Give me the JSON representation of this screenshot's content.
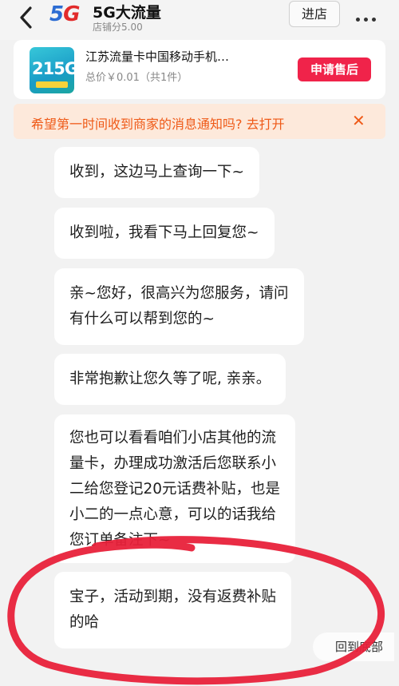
{
  "header": {
    "logo_5": "5",
    "logo_g": "G",
    "shop_name": "5G大流量",
    "shop_score": "店铺分5.00",
    "enter_store": "进店"
  },
  "product": {
    "thumb_text": "215G",
    "title": "江苏流量卡中国移动手机…",
    "price": "总价￥0.01（共1件）",
    "aftersale": "申请售后"
  },
  "notify": {
    "text": "希望第一时间收到商家的消息通知吗? 去打开",
    "close": "✕"
  },
  "messages": [
    {
      "lines": [
        "收到，这边马上查询一下~"
      ]
    },
    {
      "lines": [
        "收到啦，我看下马上回复您~"
      ]
    },
    {
      "lines": [
        "亲~您好，很高兴为您服务，请问",
        "有什么可以帮到您的~"
      ]
    },
    {
      "lines": [
        "非常抱歉让您久等了呢, 亲亲。"
      ]
    },
    {
      "lines": [
        "您也可以看看咱们小店其他的流",
        "量卡，办理成功激活后您联系小",
        "二给您登记20元话费补贴，也是",
        "小二的一点心意，可以的话我给",
        "您订单备注下~"
      ]
    },
    {
      "lines": [
        "宝子，活动到期，没有返费补贴",
        "的哈"
      ]
    }
  ],
  "scroll_to_bottom": "回到底部",
  "colors": {
    "accent_red": "#f0234a",
    "notify_orange": "#ef5a18",
    "annotation_red": "#e8213a"
  }
}
